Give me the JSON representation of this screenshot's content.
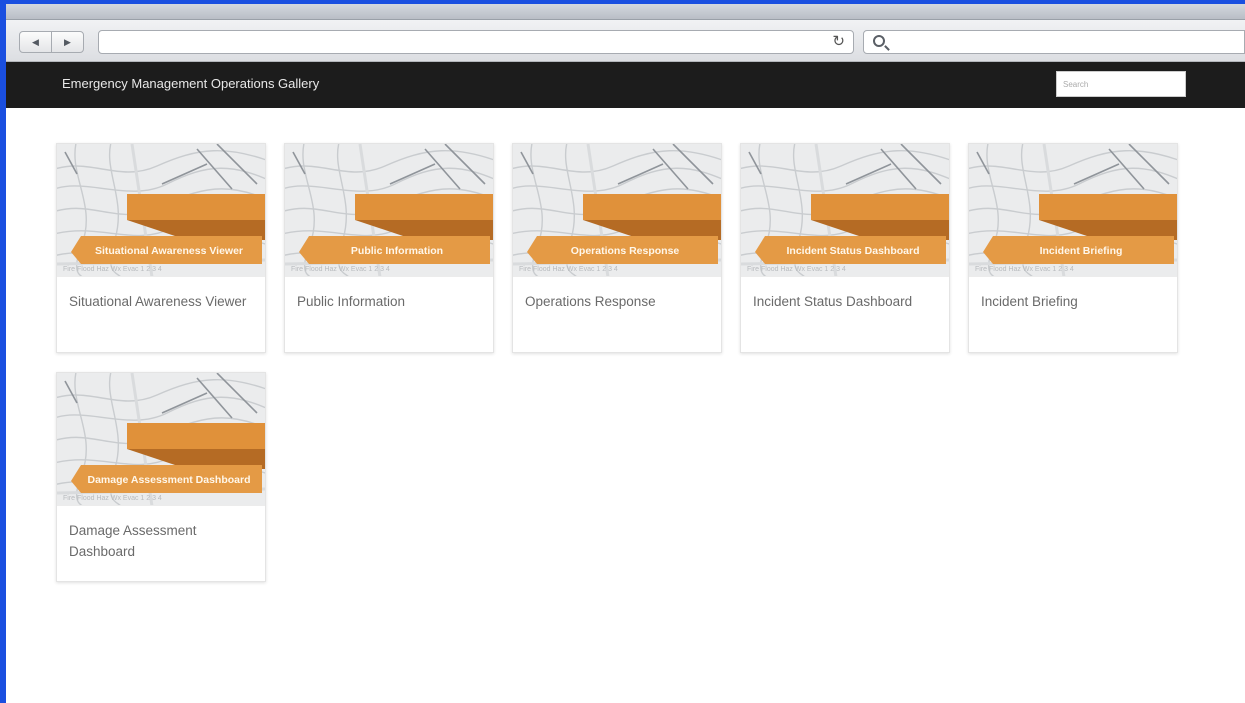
{
  "app": {
    "title": "Emergency Management Operations Gallery",
    "search_placeholder": "Search"
  },
  "browser": {
    "url": ""
  },
  "colors": {
    "ribbon": "#e0913a",
    "ribbon_dark": "#b56b24",
    "header_bg": "#1c1c1c"
  },
  "cards": [
    {
      "banner": "Situational Awareness Viewer",
      "title": "Situational Awareness Viewer"
    },
    {
      "banner": "Public Information",
      "title": "Public Information"
    },
    {
      "banner": "Operations Response",
      "title": "Operations Response"
    },
    {
      "banner": "Incident Status Dashboard",
      "title": "Incident Status Dashboard"
    },
    {
      "banner": "Incident Briefing",
      "title": "Incident Briefing"
    },
    {
      "banner": "Damage Assessment Dashboard",
      "title": "Damage Assessment Dashboard"
    }
  ]
}
